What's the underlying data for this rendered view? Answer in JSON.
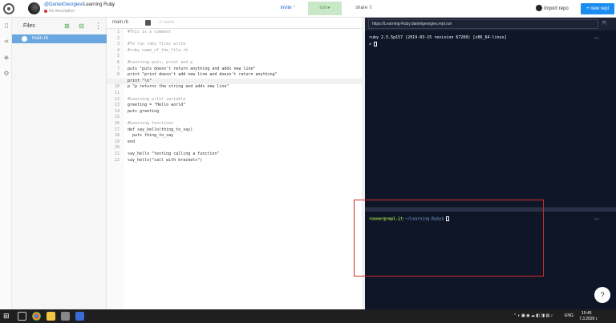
{
  "header": {
    "user_link": "@DanielGeorgiev",
    "repl_name": "Learning Ruby",
    "description": "No description",
    "invite_label": "invite",
    "run_label": "run",
    "share_label": "share",
    "import_label": "Import repo",
    "new_repl_label": "+ new repl",
    "colors": {
      "accent": "#1b8cf0",
      "run_bg": "#c9e8c7",
      "run_text": "#4c9a48"
    }
  },
  "files": {
    "title": "Files",
    "items": [
      {
        "name": "main.rb"
      }
    ]
  },
  "editor": {
    "tab_name": "main.rb",
    "saved_label": "saved",
    "lines": [
      {
        "n": "1",
        "text": "#This is a comment"
      },
      {
        "n": "2",
        "text": ""
      },
      {
        "n": "3",
        "text": "#To run ruby files write"
      },
      {
        "n": "4",
        "text": "#ruby name_of_the_file.rb"
      },
      {
        "n": "5",
        "text": ""
      },
      {
        "n": "6",
        "text": "#Learning puts, print and p"
      },
      {
        "n": "7",
        "text": "puts \"puts doesn't return anything and adds new line\""
      },
      {
        "n": "8",
        "text": "print \"print doesn't add new line and doesn't return anything\""
      },
      {
        "n": "9",
        "text": "print \"\\n\""
      },
      {
        "n": "10",
        "text": "p \"p returns the string and adds new line\""
      },
      {
        "n": "11",
        "text": ""
      },
      {
        "n": "12",
        "text": "#Learning print variable"
      },
      {
        "n": "13",
        "text": "greeting = \"Hello world\""
      },
      {
        "n": "14",
        "text": "puts greeting"
      },
      {
        "n": "15",
        "text": ""
      },
      {
        "n": "16",
        "text": "#Learning functions"
      },
      {
        "n": "17",
        "text": "def say_hello(thing_to_say)"
      },
      {
        "n": "18",
        "text": "  puts thing_to_say"
      },
      {
        "n": "19",
        "text": "end"
      },
      {
        "n": "20",
        "text": ""
      },
      {
        "n": "21",
        "text": "say_hello \"testing calling a function\""
      },
      {
        "n": "22",
        "text": "say_hello(\"call with brackets\")"
      }
    ]
  },
  "console": {
    "url": "https://Learning-Ruby.danielgeorgiev.repl.run",
    "version_line": "ruby 2.5.5p157 (2019-03-15 revision 67260) [x86_64-linux]",
    "repl_prompt": ">",
    "shell_user": "runner@repl.it",
    "shell_path": ":~/Learning-Ruby$",
    "help_label": "?"
  },
  "taskbar": {
    "language": "ENG",
    "time": "15:45",
    "date": "7.3.2020 г."
  }
}
